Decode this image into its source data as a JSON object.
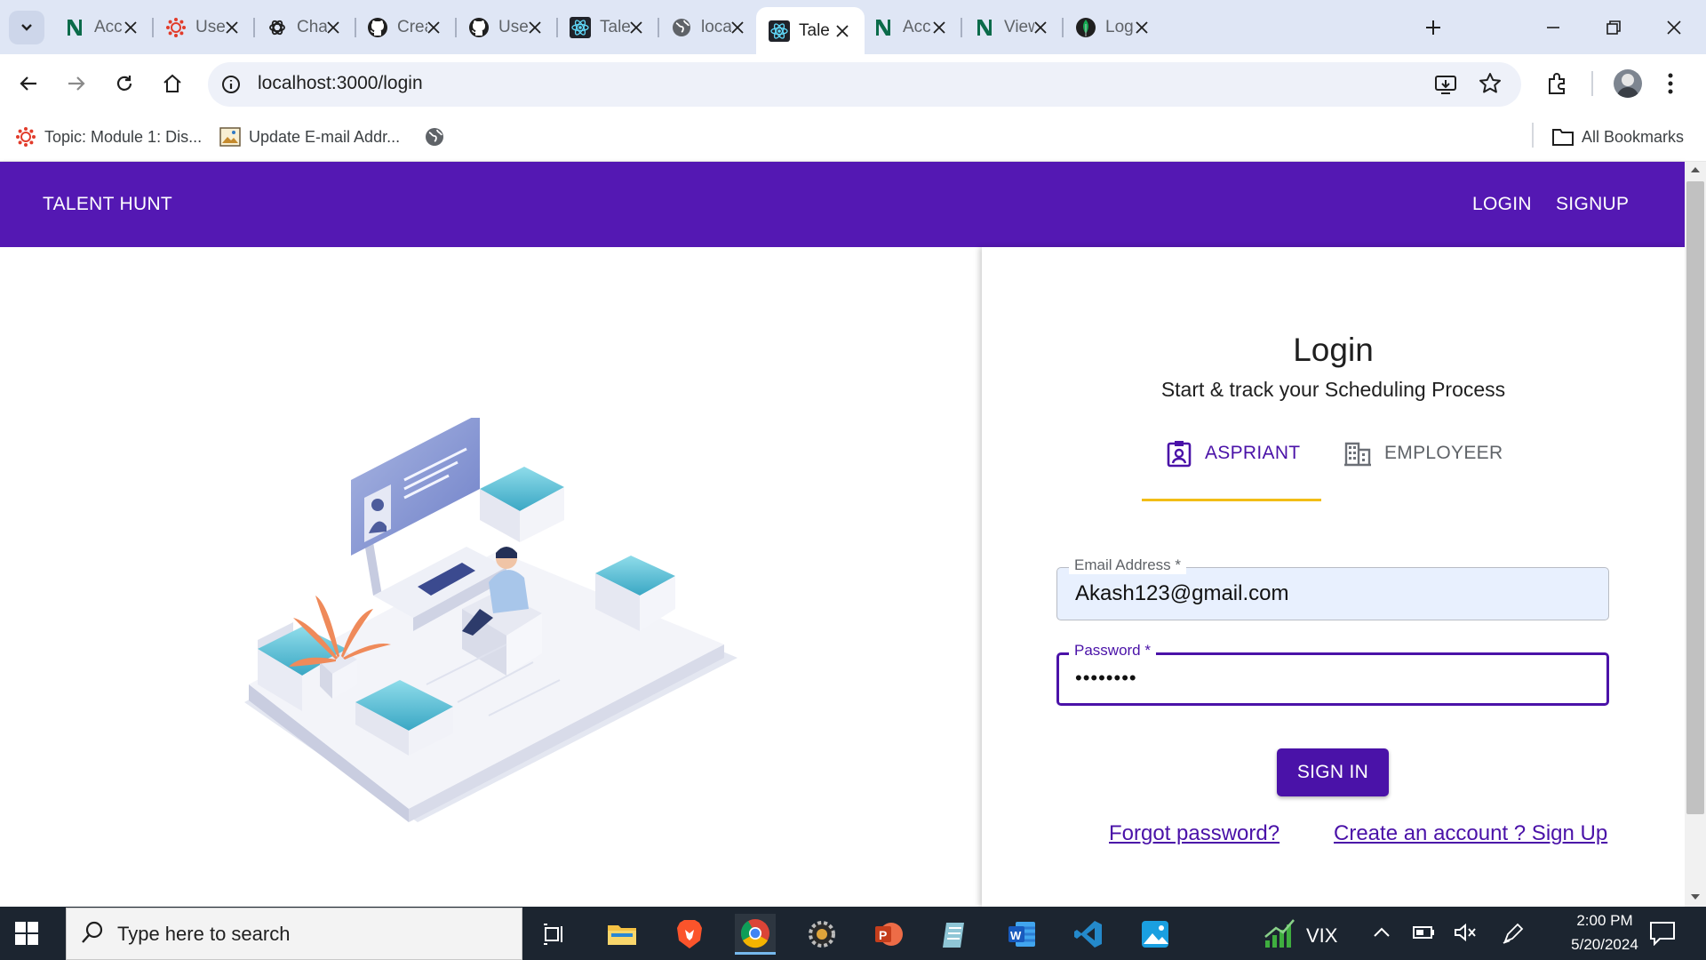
{
  "browser": {
    "tabs": [
      {
        "title": "Acc",
        "icon": "notion-n-icon"
      },
      {
        "title": "User",
        "icon": "canvas-icon"
      },
      {
        "title": "Cha",
        "icon": "chatgpt-icon"
      },
      {
        "title": "Crea",
        "icon": "github-icon"
      },
      {
        "title": "Use",
        "icon": "github-icon"
      },
      {
        "title": "Tale",
        "icon": "react-icon"
      },
      {
        "title": "loca",
        "icon": "globe-icon"
      },
      {
        "title": "Tale",
        "icon": "react-icon",
        "active": true
      },
      {
        "title": "Acc",
        "icon": "notion-n-icon"
      },
      {
        "title": "View",
        "icon": "notion-n-icon"
      },
      {
        "title": "Log",
        "icon": "mongodb-leaf-icon"
      }
    ],
    "url": "localhost:3000/login",
    "bookmarks": [
      {
        "label": "Topic: Module 1: Dis...",
        "icon": "canvas-icon"
      },
      {
        "label": "Update E-mail Addr...",
        "icon": "image-icon"
      },
      {
        "label": "",
        "icon": "globe-icon"
      }
    ],
    "all_bookmarks": "All Bookmarks"
  },
  "app": {
    "brand": "TALENT HUNT",
    "nav": {
      "login": "LOGIN",
      "signup": "SIGNUP"
    },
    "login": {
      "title": "Login",
      "subtitle": "Start & track your Scheduling Process",
      "tabs": [
        {
          "label": "ASPRIANT",
          "icon": "id-badge-icon",
          "selected": true
        },
        {
          "label": "EMPLOYEER",
          "icon": "building-icon",
          "selected": false
        }
      ],
      "email_label": "Email Address *",
      "email_value": "Akash123@gmail.com",
      "password_label": "Password *",
      "password_value": "••••••••",
      "submit": "SIGN IN",
      "forgot": "Forgot password?",
      "create": "Create an account ? Sign Up"
    },
    "colors": {
      "primary": "#5418b3",
      "accent": "#4a12a8",
      "tab_indicator": "#f2bd16"
    }
  },
  "taskbar": {
    "search_placeholder": "Type here to search",
    "vix_label": "VIX",
    "time": "2:00 PM",
    "date": "5/20/2024"
  }
}
